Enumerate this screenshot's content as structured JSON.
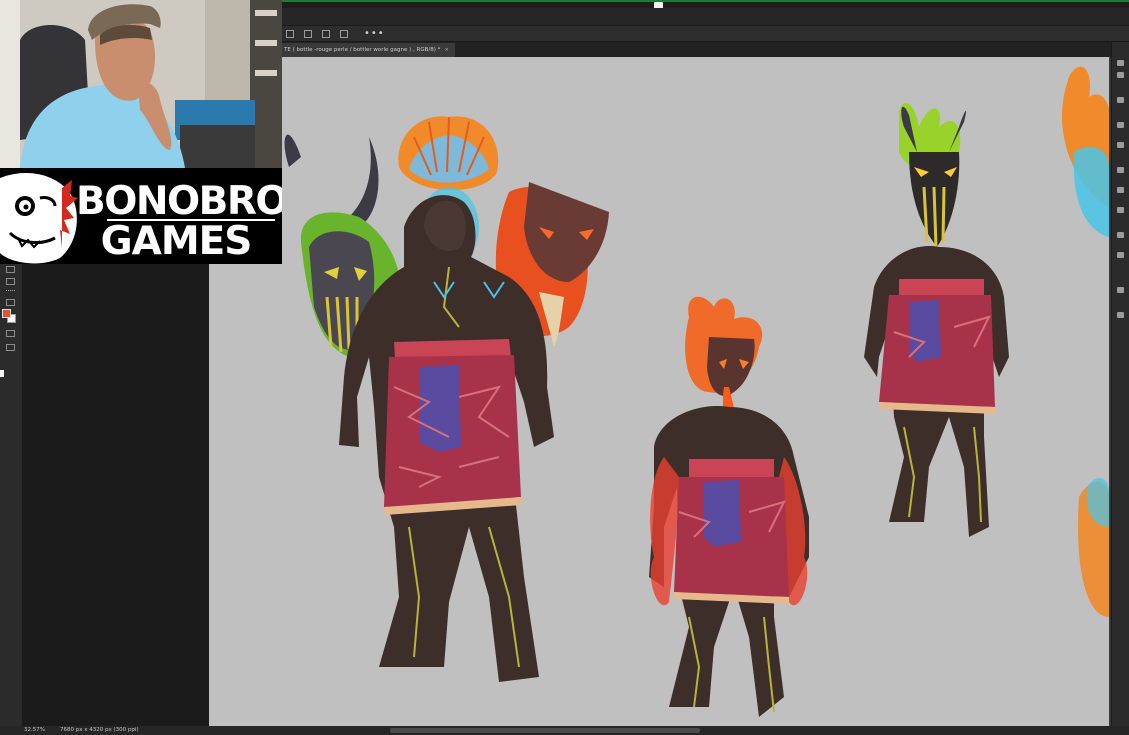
{
  "document": {
    "tab_title": "TE ( bottle -rouge perle / bottler worle gagne ) , RGB/8) *",
    "tab_close": "×"
  },
  "toolbar": {
    "more_options": "•••"
  },
  "status": {
    "zoom": "32.57%",
    "doc_size": "7680 px x 4320 px (300 ppi)",
    "arrow": "›"
  },
  "overlay": {
    "brand_line1": "BONOBROS",
    "brand_line2": "GAMES"
  },
  "colors": {
    "foreground_swatch": "#e8502a",
    "background_swatch": "#ffffff",
    "canvas_bg": "#c0c0c0"
  },
  "icons": [
    "move-icon",
    "align-icon",
    "select-icon",
    "lasso-icon",
    "crop-icon",
    "brush-icon",
    "eraser-icon",
    "zoom-icon",
    "layers-icon",
    "adjustments-icon"
  ]
}
